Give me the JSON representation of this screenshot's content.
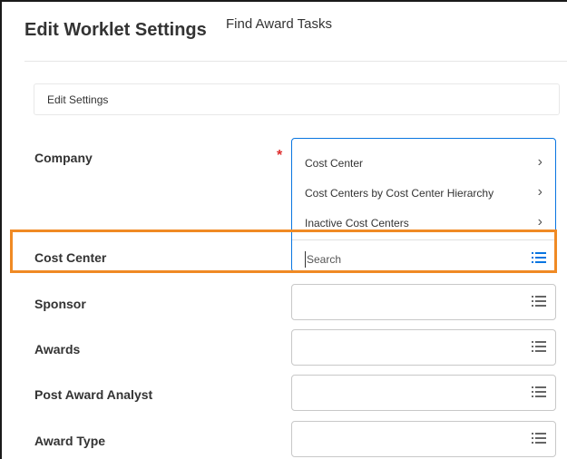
{
  "header": {
    "title": "Edit Worklet Settings",
    "subtitle": "Find Award Tasks"
  },
  "section": {
    "title": "Edit Settings"
  },
  "fields": {
    "company": {
      "label": "Company",
      "required": true
    },
    "cost_center": {
      "label": "Cost Center"
    },
    "sponsor": {
      "label": "Sponsor"
    },
    "awards": {
      "label": "Awards"
    },
    "post_award_analyst": {
      "label": "Post Award Analyst"
    },
    "award_type": {
      "label": "Award Type"
    }
  },
  "dropdown": {
    "items": [
      {
        "label": "Cost Center"
      },
      {
        "label": "Cost Centers by Cost Center Hierarchy"
      },
      {
        "label": "Inactive Cost Centers"
      }
    ],
    "search_placeholder": "Search"
  },
  "required_marker": "*",
  "chevron_glyph": "›",
  "colors": {
    "accent_blue": "#0875e1",
    "highlight_orange": "#f08a24",
    "required_red": "#de2b2b"
  },
  "icons": {
    "list_icon": "prompt-list-icon",
    "chevron": "chevron-right-icon"
  }
}
